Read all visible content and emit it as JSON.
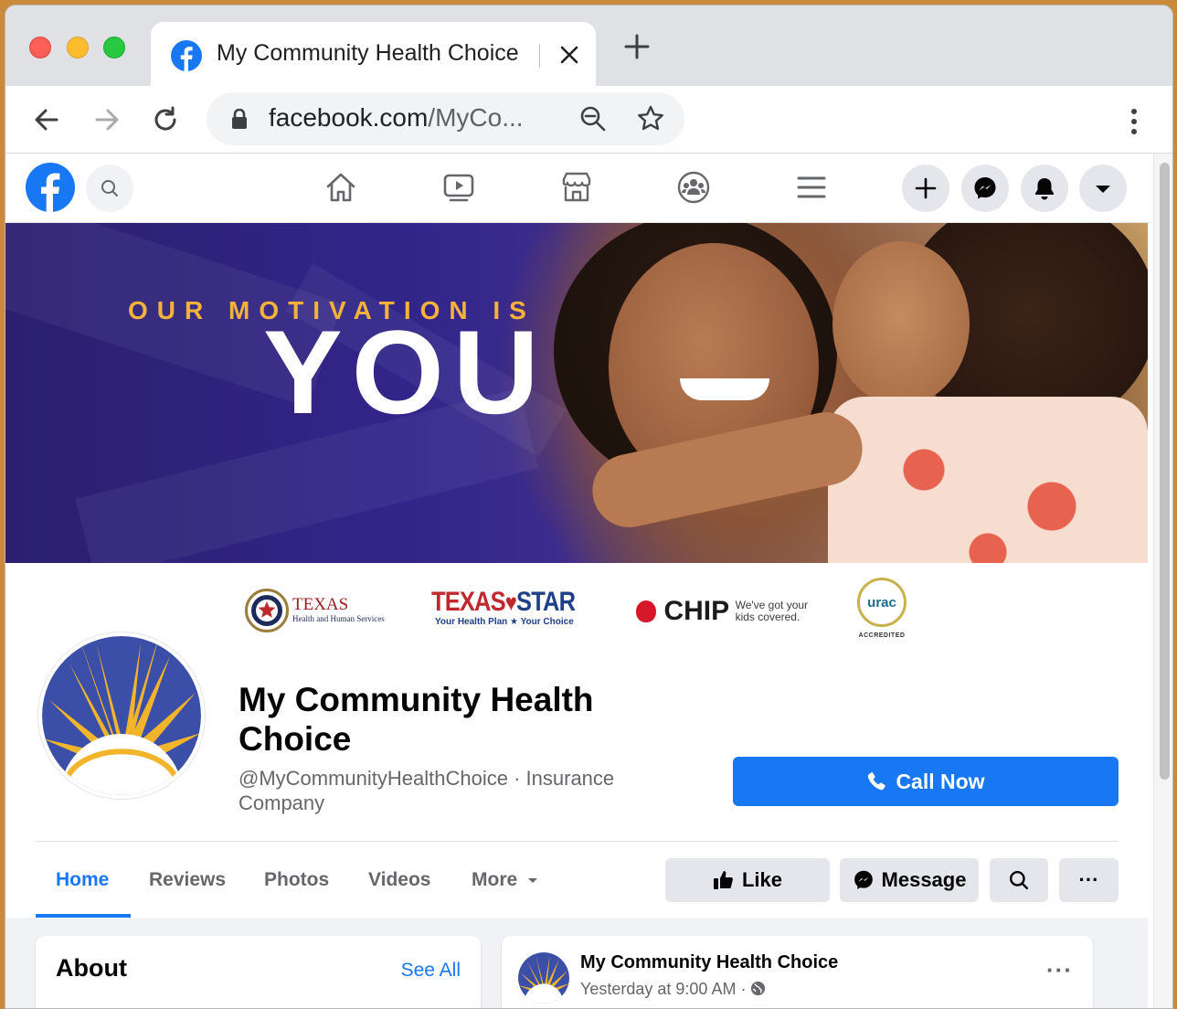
{
  "browser": {
    "tab_title": "My Community Health Choice",
    "url_host": "facebook.com",
    "url_path": "/MyCo..."
  },
  "cover": {
    "kicker": "OUR MOTIVATION IS",
    "headline": "YOU"
  },
  "partners": {
    "hhs_name": "TEXAS",
    "hhs_sub": "Health and Human Services",
    "star_main_left": "TEXAS",
    "star_main_right": "STAR",
    "star_sub": "Your Health Plan  ★  Your Choice",
    "chip_word": "CHIP",
    "chip_tag_1": "We've got your",
    "chip_tag_2": "kids covered.",
    "urac_word": "urac",
    "urac_sub": "ACCREDITED"
  },
  "page": {
    "name": "My Community Health Choice",
    "subtitle": "@MyCommunityHealthChoice · Insurance Company",
    "call_label": "Call Now"
  },
  "tabs": [
    {
      "label": "Home"
    },
    {
      "label": "Reviews"
    },
    {
      "label": "Photos"
    },
    {
      "label": "Videos"
    },
    {
      "label": "More"
    }
  ],
  "actions": {
    "like": "Like",
    "message": "Message",
    "more": "···"
  },
  "about": {
    "title": "About",
    "see_all": "See All"
  },
  "post": {
    "author": "My Community Health Choice",
    "time": "Yesterday at 9:00 AM ·",
    "more": "···"
  },
  "colors": {
    "fb_blue": "#1877f2",
    "cover_purple": "#32258a",
    "cover_gold": "#f4b23a"
  },
  "icons": [
    "facebook-icon",
    "close-icon",
    "plus-icon",
    "back-arrow-icon",
    "forward-arrow-icon",
    "reload-icon",
    "lock-icon",
    "zoom-icon",
    "star-icon",
    "kebab-icon",
    "search-icon",
    "home-icon",
    "watch-icon",
    "marketplace-icon",
    "groups-icon",
    "menu-icon",
    "messenger-icon",
    "bell-icon",
    "caret-down-icon",
    "phone-icon",
    "thumbs-up-icon",
    "globe-icon"
  ]
}
